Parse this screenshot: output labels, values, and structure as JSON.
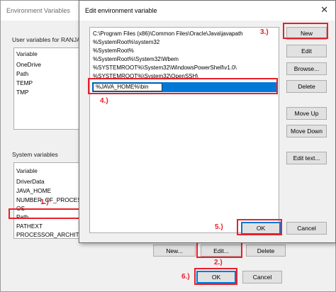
{
  "env_window": {
    "title": "Environment Variables",
    "user_group_label": "User variables for RANJAN",
    "user_list": {
      "header": "Variable",
      "items": [
        "OneDrive",
        "Path",
        "TEMP",
        "TMP"
      ]
    },
    "system_group_label": "System variables",
    "system_list": {
      "header": "Variable",
      "items": [
        "DriverData",
        "JAVA_HOME",
        "NUMBER_OF_PROCESSORS",
        "OS",
        "Path",
        "PATHEXT",
        "PROCESSOR_ARCHITECT"
      ]
    },
    "buttons": {
      "new": "New...",
      "edit": "Edit...",
      "delete": "Delete",
      "ok": "OK",
      "cancel": "Cancel"
    }
  },
  "edit_dialog": {
    "title": "Edit environment variable",
    "close_glyph": "✕",
    "entries": [
      "C:\\Program Files (x86)\\Common Files\\Oracle\\Java\\javapath",
      "%SystemRoot%\\system32",
      "%SystemRoot%",
      "%SystemRoot%\\System32\\Wbem",
      "%SYSTEMROOT%\\System32\\WindowsPowerShell\\v1.0\\",
      "%SYSTEMROOT%\\System32\\OpenSSH\\"
    ],
    "new_entry_value": "%JAVA_HOME%\\bin",
    "buttons": {
      "new": "New",
      "edit": "Edit",
      "browse": "Browse...",
      "delete": "Delete",
      "move_up": "Move Up",
      "move_down": "Move Down",
      "edit_text": "Edit text...",
      "ok": "OK",
      "cancel": "Cancel"
    }
  },
  "annotations": {
    "step1": "1.)",
    "step2": "2.)",
    "step3": "3.)",
    "step4": "4.)",
    "step5": "5.)",
    "step6": "6.)"
  },
  "colors": {
    "annotation_red": "#e8202a",
    "selection_blue": "#0078d7"
  }
}
